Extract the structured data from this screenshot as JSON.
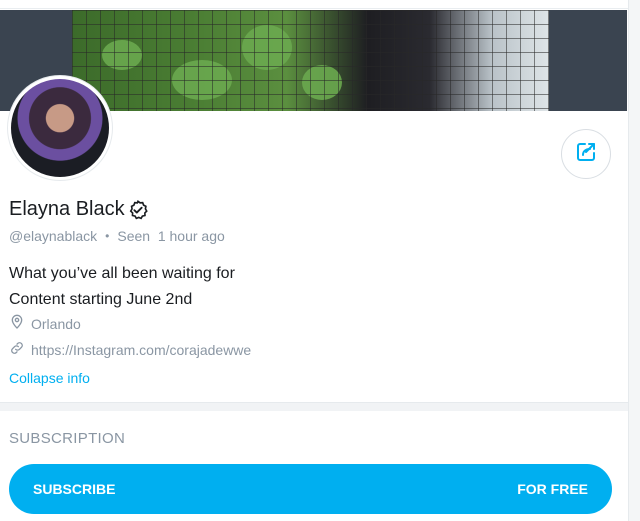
{
  "profile": {
    "name": "Elayna Black",
    "handle": "@elaynablack",
    "separator": "•",
    "seen": "Seen  1 hour ago",
    "bio_lines": [
      "What you’ve all been waiting for",
      "Content starting June 2nd"
    ],
    "location": "Orlando",
    "link": "https://Instagram.com/corajadewwe",
    "collapse_label": "Collapse info"
  },
  "subscription": {
    "title": "SUBSCRIPTION",
    "button_left": "SUBSCRIBE",
    "button_right": "FOR FREE"
  },
  "icons": {
    "share": "share-icon",
    "verified": "verified-badge-icon",
    "location": "location-pin-icon",
    "link": "link-icon"
  },
  "colors": {
    "accent": "#00aff0",
    "muted_text": "#8a96a3",
    "primary_text": "#1a1d21"
  }
}
